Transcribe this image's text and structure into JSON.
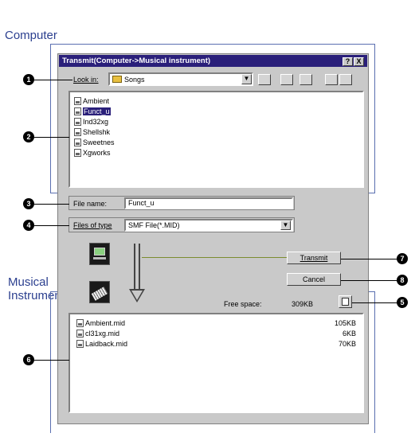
{
  "labels": {
    "computer": "Computer",
    "musical": "Musical",
    "instrument": "Instrument"
  },
  "dialog": {
    "title": "Transmit(Computer->Musical instrument)",
    "help_btn": "?",
    "close_btn": "X",
    "look_in_label": "Look in:",
    "look_in_value": "Songs",
    "computer_files": [
      "Ambient",
      "Funct_u",
      "Ind32xg",
      "Shellshk",
      "Sweetnes",
      "Xgworks"
    ],
    "selected_file": "Funct_u",
    "file_name_label": "File name:",
    "file_name_value": "Funct_u",
    "files_of_type_label": "Files of type",
    "files_of_type_value": "SMF File(*.MID)",
    "transmit_btn": "Transmit",
    "cancel_btn": "Cancel",
    "free_space_label": "Free space:",
    "free_space_value": "309KB",
    "instrument_files": [
      {
        "name": "Ambient.mid",
        "size": "105KB"
      },
      {
        "name": "cl31xg.mid",
        "size": "6KB"
      },
      {
        "name": "Laidback.mid",
        "size": "70KB"
      }
    ]
  },
  "callouts": [
    "1",
    "2",
    "3",
    "4",
    "5",
    "6",
    "7",
    "8"
  ]
}
